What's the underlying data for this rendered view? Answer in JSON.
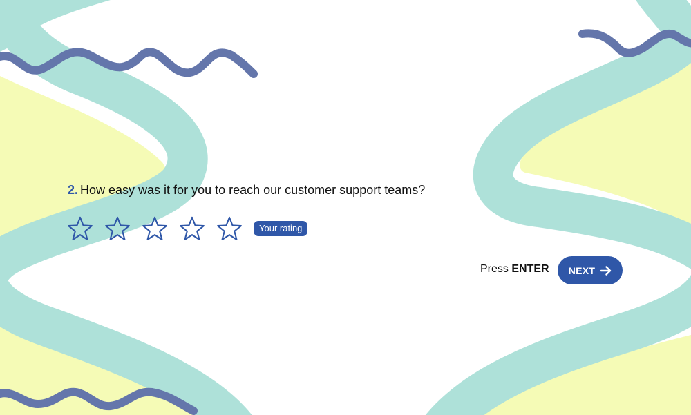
{
  "colors": {
    "accent": "#2f57a8",
    "teal": "#aee1d9",
    "yellow": "#f5fbb6",
    "squiggle": "#6476ab"
  },
  "question": {
    "number": "2.",
    "text": "How easy was it for you to reach our customer support teams?"
  },
  "rating": {
    "icon": "star-outline-icon",
    "max_stars": 5,
    "selected": 0,
    "badge": "Your rating"
  },
  "footer": {
    "press_prefix": "Press",
    "press_key": "ENTER",
    "next_label": "NEXT",
    "next_icon": "arrow-right-icon"
  }
}
